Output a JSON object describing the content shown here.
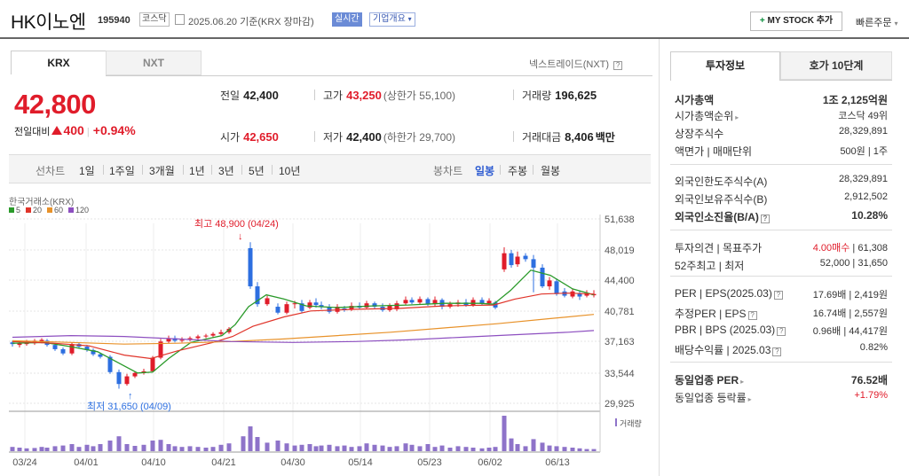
{
  "header": {
    "name": "HK이노엔",
    "code": "195940",
    "market": "코스닥",
    "date": "2025.06.20 기준(KRX 장마감)",
    "realtime": "실시간",
    "overview": "기업개요",
    "mystock_label": "MY STOCK 추가",
    "quick_order": "빠른주문"
  },
  "exchange_tabs": [
    "KRX",
    "NXT"
  ],
  "nxt_link": "넥스트레이드(NXT)",
  "price": {
    "current": "42,800",
    "change_label": "전일대비",
    "change_amount": "400",
    "change_pct": "+0.94%"
  },
  "stats": {
    "prev_label": "전일",
    "prev": "42,400",
    "high_label": "고가",
    "high": "43,250",
    "upper_limit": "(상한가 55,100)",
    "volume_label": "거래량",
    "volume": "196,625",
    "open_label": "시가",
    "open": "42,650",
    "low_label": "저가",
    "low": "42,400",
    "lower_limit": "(하한가 29,700)",
    "value_label": "거래대금",
    "value": "8,406",
    "value_unit": "백만"
  },
  "period_bar": {
    "line_label": "선차트",
    "line_periods": [
      "1일",
      "1주일",
      "3개월",
      "1년",
      "3년",
      "5년",
      "10년"
    ],
    "candle_label": "봉차트",
    "candle_periods": [
      "일봉",
      "주봉",
      "월봉"
    ],
    "active": "일봉"
  },
  "right_panel": {
    "tabs": [
      "투자정보",
      "호가 10단계"
    ],
    "rows": [
      {
        "k": "시가총액",
        "v": "1조 2,125억원",
        "bold": true
      },
      {
        "k": "시가총액순위",
        "v": "코스닥 49위"
      },
      {
        "k": "상장주식수",
        "v": "28,329,891"
      },
      {
        "k": "액면가 | 매매단위",
        "v": "500원 | 1주"
      },
      {
        "k": "외국인한도주식수(A)",
        "v": "28,329,891"
      },
      {
        "k": "외국인보유주식수(B)",
        "v": "2,912,502"
      },
      {
        "k": "외국인소진율(B/A)",
        "v": "10.28%",
        "bold": true
      },
      {
        "k": "투자의견 | 목표주가",
        "v_red": "4.00매수",
        "v": " | 61,308"
      },
      {
        "k": "52주최고 | 최저",
        "v": "52,000 | 31,650"
      },
      {
        "k": "PER | EPS(2025.03)",
        "v": "17.69배 | 2,419원"
      },
      {
        "k": "추정PER | EPS",
        "v": "16.74배 | 2,557원"
      },
      {
        "k": "PBR | BPS (2025.03)",
        "v": "0.96배 | 44,417원"
      },
      {
        "k": "배당수익률 | 2025.03",
        "v": "0.82%"
      },
      {
        "k": "동일업종 PER",
        "v": "76.52배",
        "bold": true
      },
      {
        "k": "동일업종 등락률",
        "v_red": "+1.79%"
      }
    ]
  },
  "chart_data": {
    "type": "candlestick",
    "source_label": "한국거래소(KRX)",
    "ma_legend": [
      {
        "name": "5",
        "color": "#2a9a2a"
      },
      {
        "name": "20",
        "color": "#e0342a"
      },
      {
        "name": "60",
        "color": "#e8922a"
      },
      {
        "name": "120",
        "color": "#8d4fc0"
      }
    ],
    "y_ticks": [
      "51,638",
      "48,019",
      "44,400",
      "40,781",
      "37,163",
      "33,544",
      "29,925"
    ],
    "x_ticks": [
      "03/24",
      "04/01",
      "04/10",
      "04/21",
      "04/30",
      "05/14",
      "05/23",
      "06/02",
      "06/13"
    ],
    "max_annotation": "최고 48,900 (04/24)",
    "min_annotation": "최저 31,650 (04/09)",
    "volume_label": "거래량",
    "up_color": "#e01c2a",
    "down_color": "#2d6fe0"
  }
}
